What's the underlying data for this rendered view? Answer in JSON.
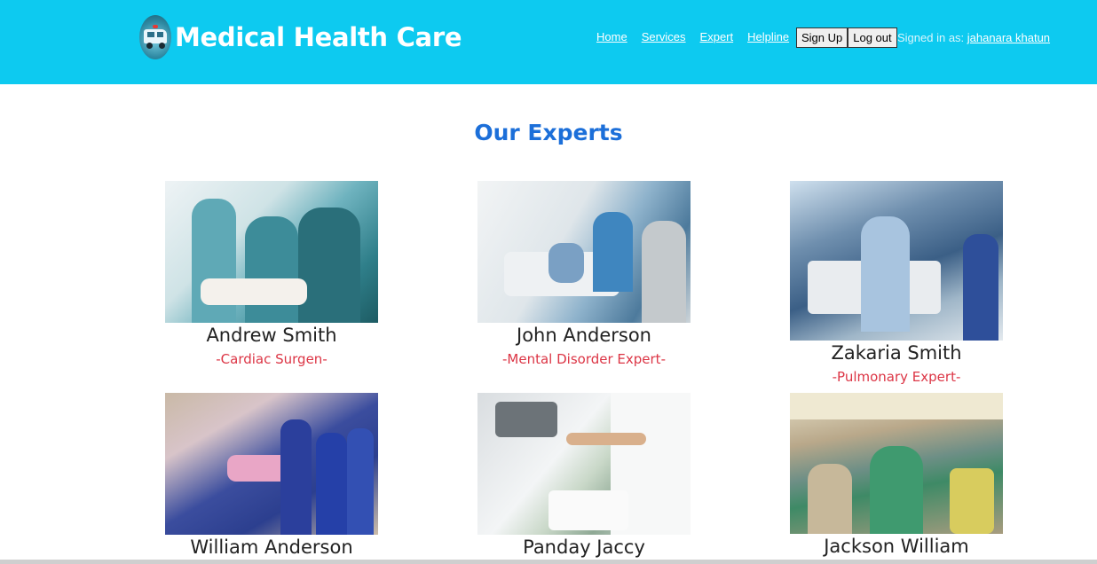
{
  "header": {
    "title": "Medical Health Care",
    "logo_icon": "ambulance-icon",
    "nav": [
      "Home",
      "Services",
      "Expert",
      "Helpline"
    ],
    "signup_label": "Sign Up",
    "logout_label": "Log out",
    "signed_in_prefix": "Signed in as:",
    "signed_in_user": "jahanara khatun",
    "color": "#0dcaf0"
  },
  "main": {
    "title": "Our Experts",
    "title_color": "#1c6fd9",
    "specialty_color": "#dc3545",
    "experts": [
      {
        "name": "Andrew Smith",
        "specialty": "-Cardiac Surgen-"
      },
      {
        "name": "John Anderson",
        "specialty": "-Mental Disorder Expert-"
      },
      {
        "name": "Zakaria Smith",
        "specialty": "-Pulmonary Expert-"
      },
      {
        "name": "William Anderson",
        "specialty": ""
      },
      {
        "name": "Panday Jaccy",
        "specialty": ""
      },
      {
        "name": "Jackson William",
        "specialty": ""
      }
    ]
  }
}
